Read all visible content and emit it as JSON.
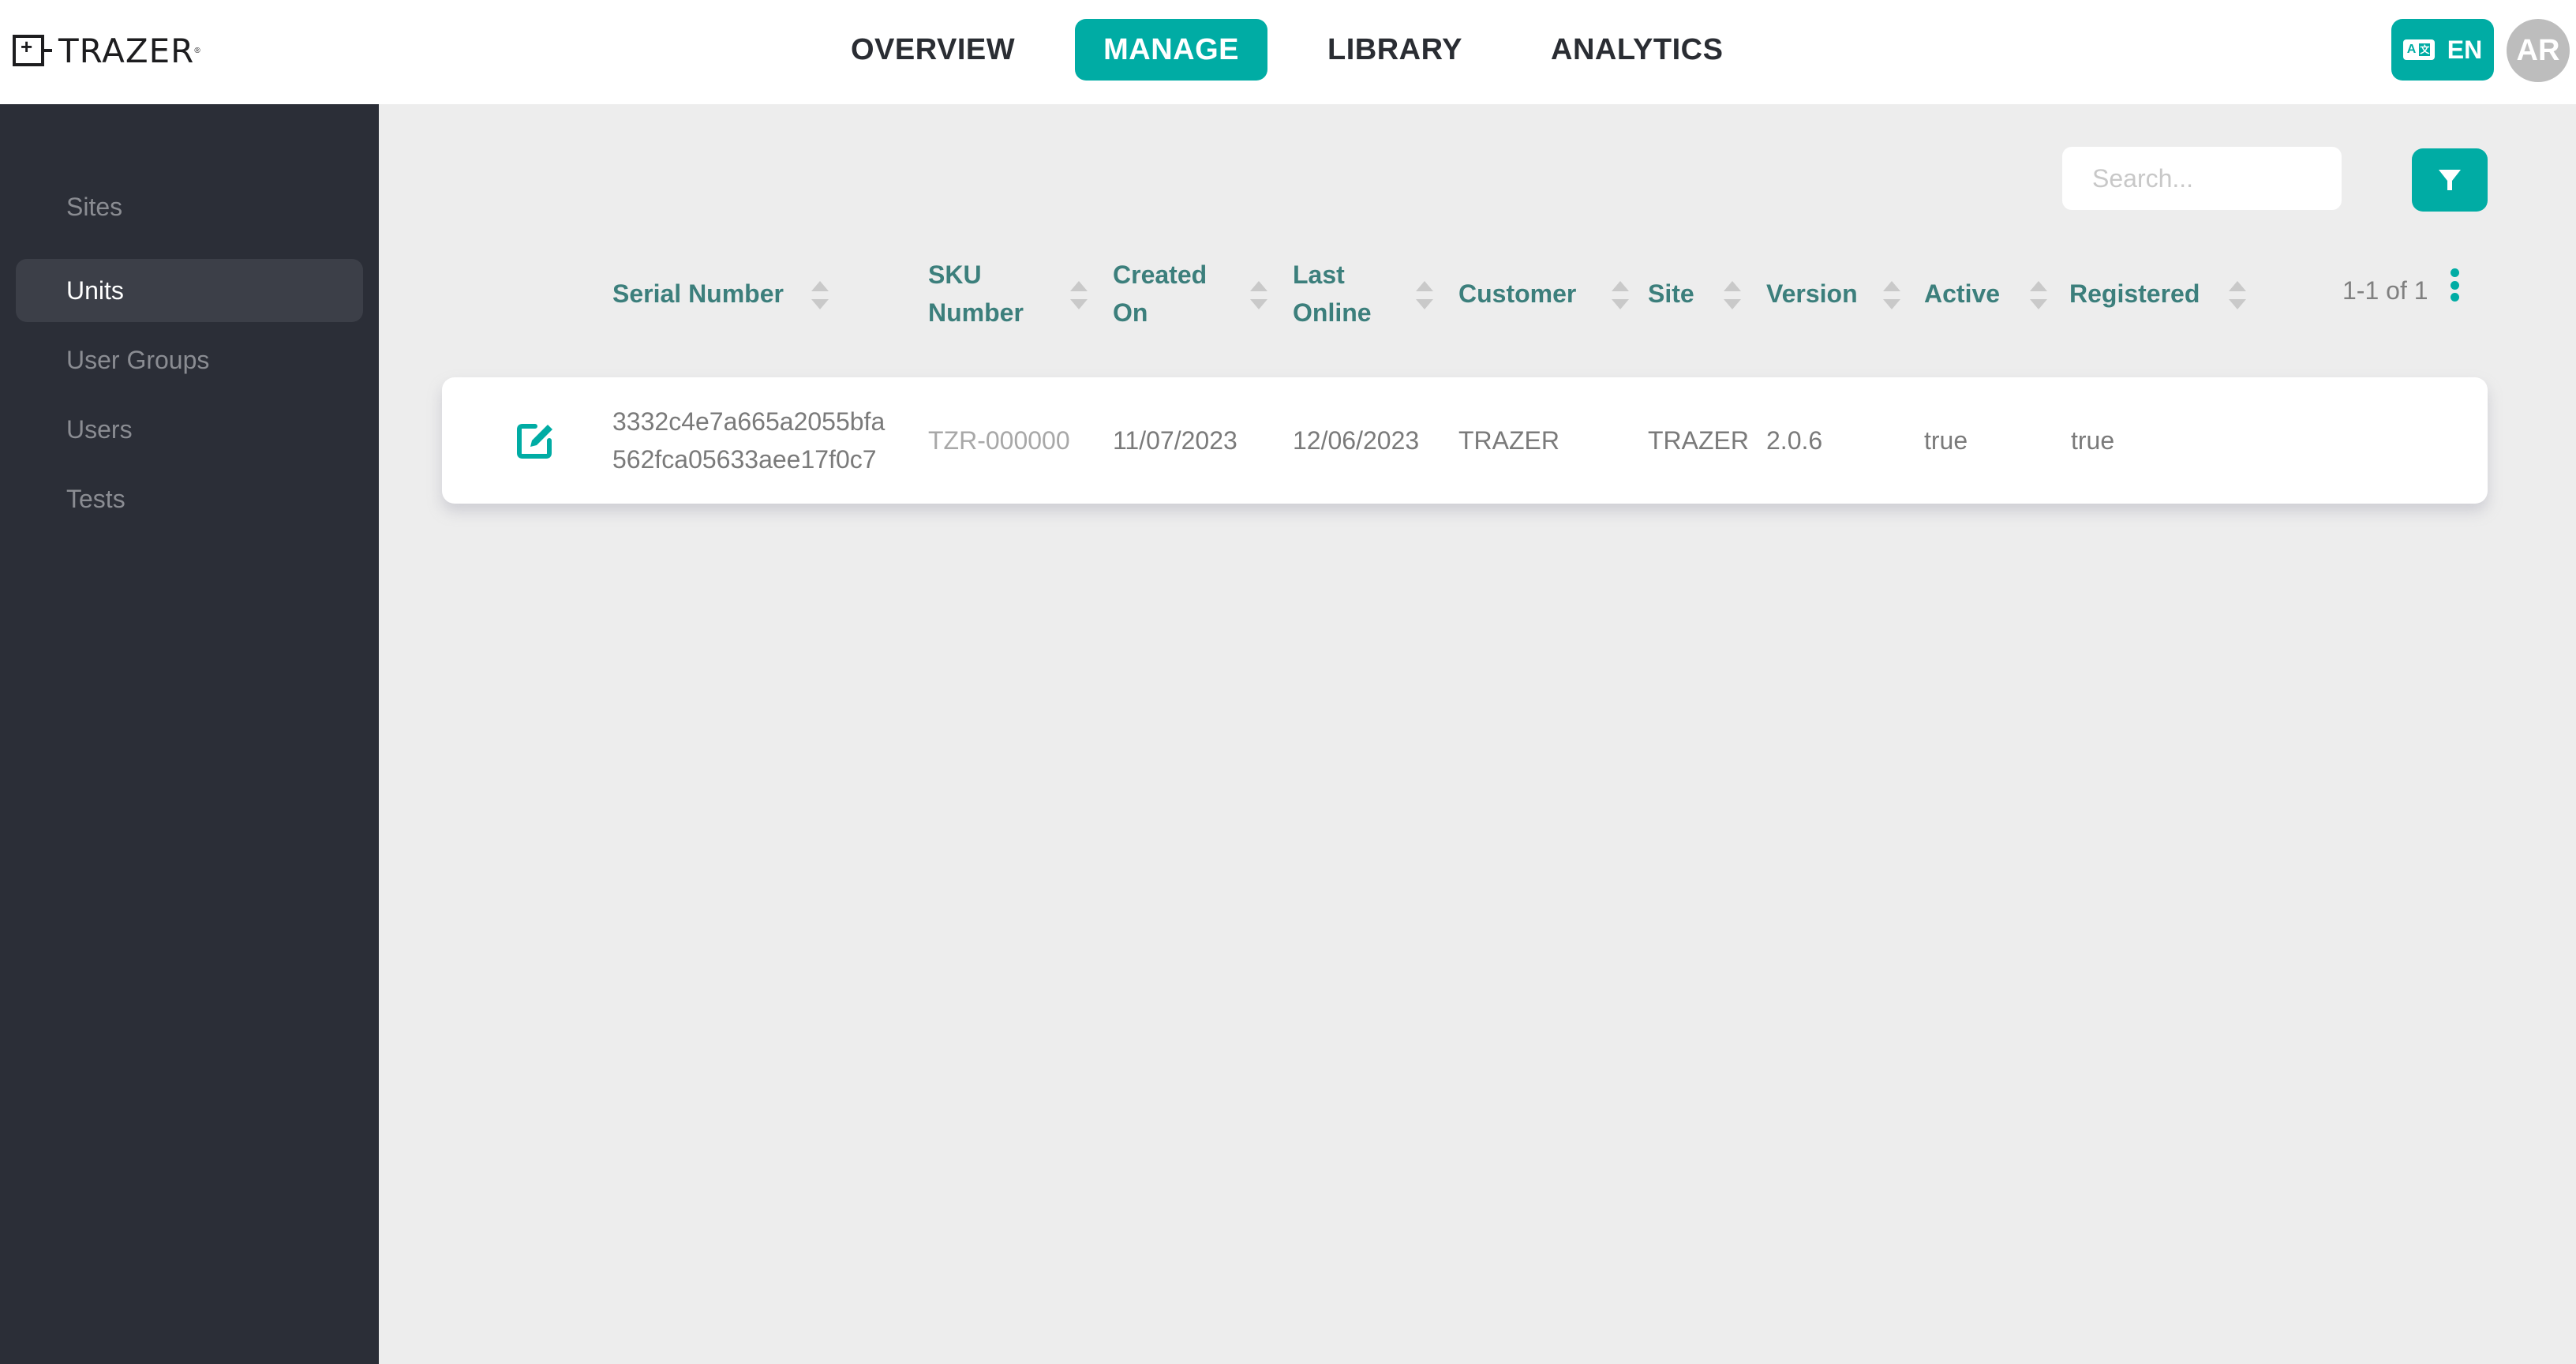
{
  "app": {
    "logo_text": "TRAZER",
    "logo_mark": "®"
  },
  "topnav": {
    "items": [
      {
        "label": "OVERVIEW",
        "active": false
      },
      {
        "label": "MANAGE",
        "active": true
      },
      {
        "label": "LIBRARY",
        "active": false
      },
      {
        "label": "ANALYTICS",
        "active": false
      }
    ],
    "language": {
      "label": "EN",
      "icon": "translate-icon"
    },
    "avatar_initials": "AR"
  },
  "sidebar": {
    "items": [
      {
        "label": "Sites",
        "active": false
      },
      {
        "label": "Units",
        "active": true
      },
      {
        "label": "User Groups",
        "active": false
      },
      {
        "label": "Users",
        "active": false
      },
      {
        "label": "Tests",
        "active": false
      }
    ]
  },
  "toolbar": {
    "search_placeholder": "Search...",
    "search_value": "",
    "search_icon": "search-icon",
    "filter_icon": "filter-icon"
  },
  "table": {
    "columns": [
      {
        "line1": "Serial Number",
        "line2": ""
      },
      {
        "line1": "SKU",
        "line2": "Number"
      },
      {
        "line1": "Created",
        "line2": "On"
      },
      {
        "line1": "Last",
        "line2": "Online"
      },
      {
        "line1": "Customer",
        "line2": ""
      },
      {
        "line1": "Site",
        "line2": ""
      },
      {
        "line1": "Version",
        "line2": ""
      },
      {
        "line1": "Active",
        "line2": ""
      },
      {
        "line1": "Registered",
        "line2": ""
      }
    ],
    "pagination": "1-1 of 1",
    "rows": [
      {
        "serial_line1": "3332c4e7a665a2055bfa",
        "serial_line2": "562fca05633aee17f0c7",
        "sku": "TZR-000000",
        "created_on": "11/07/2023",
        "last_online": "12/06/2023",
        "customer": "TRAZER",
        "site": "TRAZER",
        "version": "2.0.6",
        "active": "true",
        "registered": "true"
      }
    ]
  },
  "colors": {
    "accent": "#00aca4",
    "header_text": "#3c7f7c",
    "sidebar_bg": "#2b2e37",
    "sidebar_active_bg": "#3c3f48",
    "page_bg": "#ededed"
  }
}
